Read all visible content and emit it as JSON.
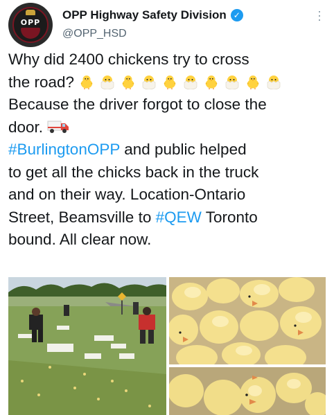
{
  "tweet_header": {
    "display_name": "OPP Highway Safety Division",
    "handle": "@OPP_HSD",
    "avatar_text": "OPP",
    "verified_icon": "verified-badge-icon"
  },
  "tweet_body": {
    "line1": "Why did 2400 chickens try to cross",
    "line2_text": "the road?",
    "emoji_name": "hatching-chick",
    "emoji_count": 10,
    "line3": "Because the driver forgot to close the",
    "line4_text": "door.",
    "truck_emoji": "delivery-truck",
    "hashtag1": "#BurlingtonOPP",
    "sentence_after_hashtag1": " and public helped",
    "line6": "to get all the chicks back in the truck",
    "line7": "and on their way. Location-Ontario",
    "line8_before": "Street, Beamsville to ",
    "hashtag2": "#QEW",
    "line8_after": " Toronto",
    "line9": "bound. All clear now."
  },
  "colors": {
    "link": "#1d9bf0",
    "text": "#14171a",
    "secondary": "#536471"
  },
  "media": {
    "image_count": 3,
    "left_image": "people-collecting-chicks-on-roadside",
    "top_right_image": "chicks-close-up",
    "bottom_right_image": "chicks-close-up-2"
  }
}
